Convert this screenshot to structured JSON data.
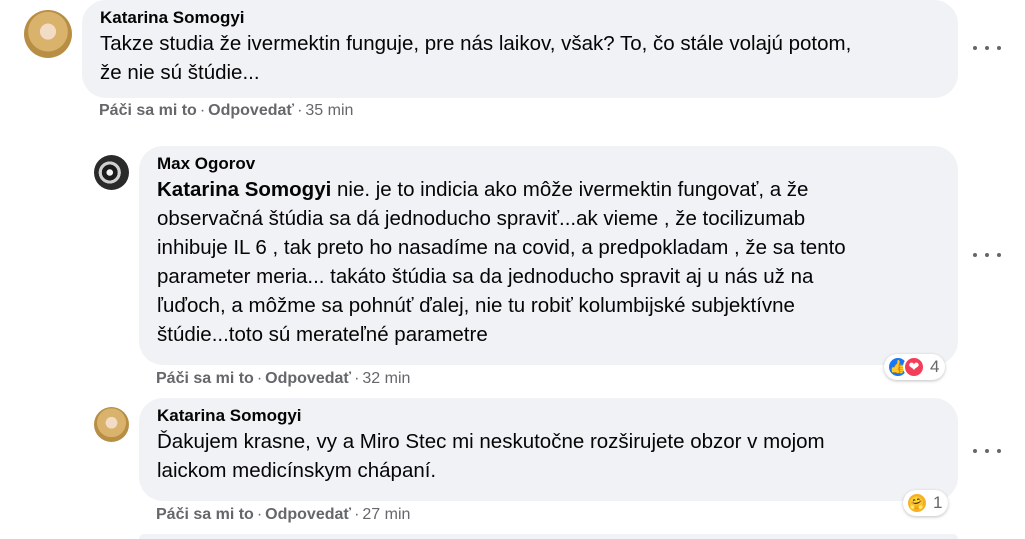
{
  "comments": [
    {
      "author": "Katarina Somogyi",
      "text_lines": [
        "Takze studia že ivermektin funguje, pre nás laikov, však? To, čo stále volajú potom,",
        "že nie sú štúdie..."
      ],
      "actions": {
        "like": "Páči sa mi to",
        "reply": "Odpovedať",
        "time": "35 min"
      }
    },
    {
      "author": "Max Ogorov",
      "mention": "Katarina Somogyi",
      "text_lines": [
        " nie. je to indicia ako môže ivermektin fungovať, a že",
        "observačná štúdia sa dá jednoducho spraviť...ak vieme , že tocilizumab",
        "inhibuje IL 6 , tak preto ho nasadíme na covid, a predpokladam , že sa tento",
        "parameter meria... takáto štúdia sa da jednoducho spravit aj u nás už na",
        "ľuďoch, a môžme sa pohnúť ďalej, nie tu robiť kolumbijské subjektívne",
        "štúdie...toto sú merateľné parametre"
      ],
      "actions": {
        "like": "Páči sa mi to",
        "reply": "Odpovedať",
        "time": "32 min"
      },
      "reactions": {
        "icons": [
          "like",
          "love"
        ],
        "count": "4"
      }
    },
    {
      "author": "Katarina Somogyi",
      "text_lines": [
        "Ďakujem krasne, vy a Miro Stec mi neskutočne rozširujete obzor v mojom",
        "laickom medicínskym chápaní."
      ],
      "actions": {
        "like": "Páči sa mi to",
        "reply": "Odpovedať",
        "time": "27 min"
      },
      "reactions": {
        "icons": [
          "care"
        ],
        "count": "1"
      }
    }
  ],
  "colors": {
    "bubble": "#f0f2f5",
    "like": "#1877f2",
    "love": "#f33e58",
    "care": "#f7b125",
    "meta": "#65676b"
  }
}
